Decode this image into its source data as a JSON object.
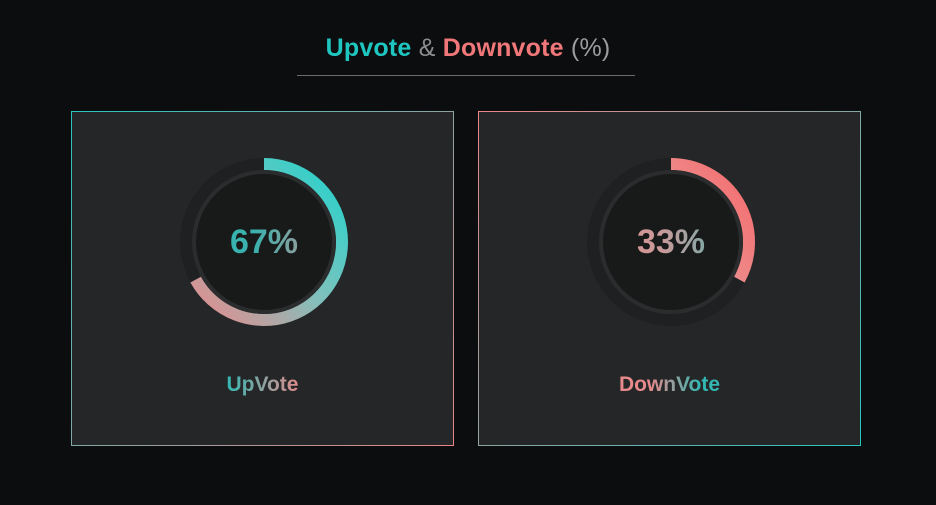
{
  "header": {
    "title_up": "Upvote",
    "title_amp": "&",
    "title_down": "Downvote",
    "title_unit": "(%)"
  },
  "cards": [
    {
      "id": "upvote",
      "value_text": "67%",
      "percent": 67,
      "label": "UpVote",
      "colors": {
        "start": "#e98a8c",
        "mid": "#7fc1bd",
        "end": "#1fd4cc"
      }
    },
    {
      "id": "downvote",
      "value_text": "33%",
      "percent": 33,
      "label": "DownVote",
      "colors": {
        "start": "#c7aeab",
        "mid": "#ef8585",
        "end": "#f46a6c"
      }
    }
  ],
  "theme": {
    "background": "#0c0d0e",
    "card_background": "#242628",
    "track": "#1f2022",
    "inner": "#181a1a",
    "up_color": "#1fc6c0",
    "down_color": "#f1787a"
  }
}
